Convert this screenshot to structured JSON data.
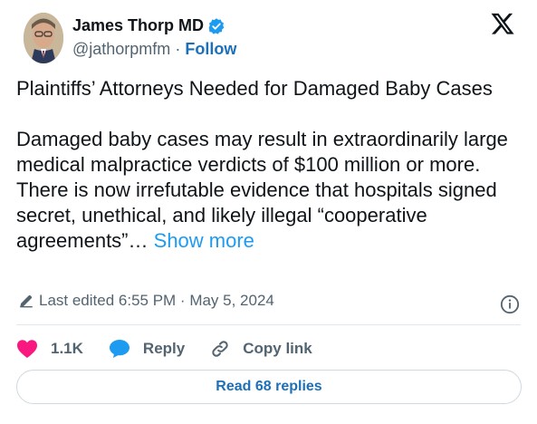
{
  "author": {
    "name": "James Thorp MD",
    "handle": "@jathorpmfm",
    "separator": "·",
    "follow_label": "Follow",
    "verified_icon": "verified-badge-icon",
    "verified_color": "#1d9bf0"
  },
  "tweet": {
    "line1": "Plaintiffs’ Attorneys Needed for Damaged Baby Cases",
    "line2": "Damaged baby cases may result in extraordinarily large medical malpractice verdicts of $100 million or more. There is now irrefutable evidence that hospitals signed secret, unethical, and likely illegal “cooperative agreements”…",
    "show_more_label": "Show more"
  },
  "meta": {
    "edited_text": "Last edited 6:55 PM · May 5, 2024",
    "edit_icon": "pencil-icon",
    "info_icon": "info-icon"
  },
  "actions": {
    "like_count": "1.1K",
    "like_color": "#f91880",
    "reply_label": "Reply",
    "reply_color": "#1d9bf0",
    "copy_label": "Copy link"
  },
  "footer": {
    "read_replies_label": "Read 68 replies"
  }
}
